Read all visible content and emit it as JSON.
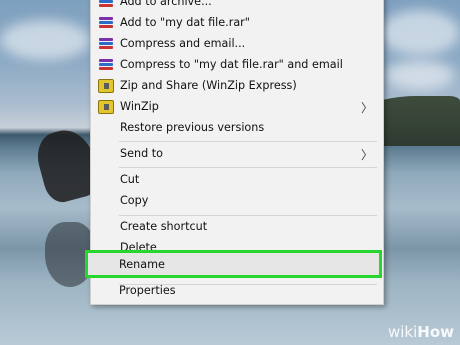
{
  "menu": {
    "items": [
      {
        "label": "Add to archive...",
        "icon": "winrar-icon",
        "submenu": false
      },
      {
        "label": "Add to \"my dat file.rar\"",
        "icon": "winrar-icon",
        "submenu": false
      },
      {
        "label": "Compress and email...",
        "icon": "winrar-icon",
        "submenu": false
      },
      {
        "label": "Compress to \"my dat file.rar\" and email",
        "icon": "winrar-icon",
        "submenu": false
      },
      {
        "label": "Zip and Share (WinZip Express)",
        "icon": "winzip-icon",
        "submenu": false
      },
      {
        "label": "WinZip",
        "icon": "winzip-icon",
        "submenu": true
      },
      {
        "label": "Restore previous versions",
        "icon": "",
        "submenu": false
      },
      {
        "label": "Send to",
        "icon": "",
        "submenu": true
      },
      {
        "label": "Cut",
        "icon": "",
        "submenu": false
      },
      {
        "label": "Copy",
        "icon": "",
        "submenu": false
      },
      {
        "label": "Create shortcut",
        "icon": "",
        "submenu": false
      },
      {
        "label": "Delete",
        "icon": "",
        "submenu": false
      },
      {
        "label": "Rename",
        "icon": "",
        "submenu": false,
        "highlighted": true,
        "highlight_color": "#27d62d"
      },
      {
        "label": "Properties",
        "icon": "",
        "submenu": false
      }
    ],
    "submenu_glyph": "〉"
  },
  "watermark": {
    "prefix": "wiki",
    "suffix": "How"
  }
}
